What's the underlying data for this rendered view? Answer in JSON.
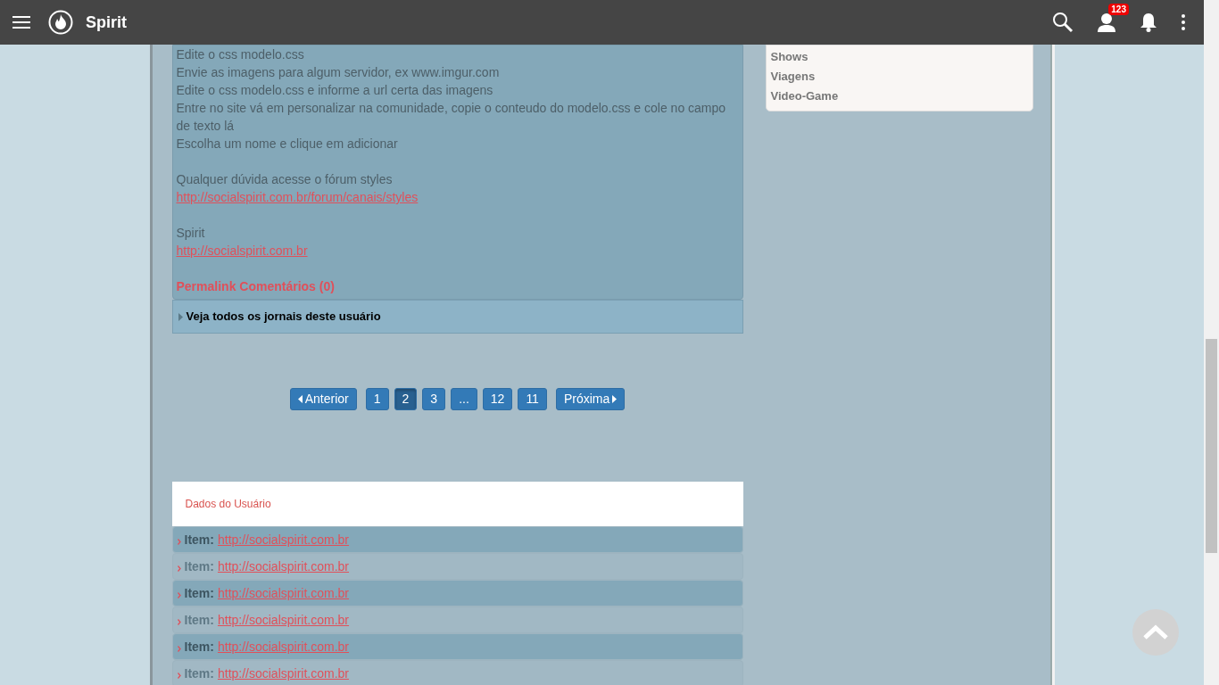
{
  "header": {
    "title": "Spirit",
    "badge": "123"
  },
  "journal": {
    "lines": [
      {
        "kind": "text",
        "text": "Edite o css modelo.css"
      },
      {
        "kind": "text",
        "text": "Envie as imagens para algum servidor, ex www.imgur.com"
      },
      {
        "kind": "text",
        "text": "Edite o css modelo.css e informe a url certa das imagens"
      },
      {
        "kind": "text",
        "text": "Entre no site vá em personalizar na comunidade, copie o conteudo do modelo.css e cole no campo de texto lá"
      },
      {
        "kind": "text",
        "text": "Escolha um nome e clique em adicionar"
      },
      {
        "kind": "blank"
      },
      {
        "kind": "text",
        "text": "Qualquer dúvida acesse o fórum styles"
      },
      {
        "kind": "link",
        "text": "http://socialspirit.com.br/forum/canais/styles"
      },
      {
        "kind": "blank"
      },
      {
        "kind": "text",
        "text": "Spirit"
      },
      {
        "kind": "link",
        "text": "http://socialspirit.com.br"
      },
      {
        "kind": "blank"
      }
    ],
    "actions": [
      "Permalink",
      "Comentários (0)"
    ],
    "more": "Veja todos os jornais deste usuário"
  },
  "pagination": {
    "previous": "Anterior",
    "next": "Próxima",
    "pages": [
      {
        "label": "1",
        "selected": false
      },
      {
        "label": "2",
        "selected": true
      },
      {
        "label": "3",
        "selected": false
      },
      {
        "label": "...",
        "selected": false
      },
      {
        "label": "12",
        "selected": false
      },
      {
        "label": "11",
        "selected": false
      }
    ]
  },
  "user_data": {
    "title": "Dados do Usuário",
    "items": [
      {
        "label": "Item:",
        "link": "http://socialspirit.com.br"
      },
      {
        "label": "Item:",
        "link": "http://socialspirit.com.br"
      },
      {
        "label": "Item:",
        "link": "http://socialspirit.com.br"
      },
      {
        "label": "Item:",
        "link": "http://socialspirit.com.br"
      },
      {
        "label": "Item:",
        "link": "http://socialspirit.com.br"
      },
      {
        "label": "Item:",
        "link": "http://socialspirit.com.br"
      }
    ]
  },
  "sidebar": {
    "categories": [
      "Shows",
      "Viagens",
      "Video-Game"
    ]
  }
}
